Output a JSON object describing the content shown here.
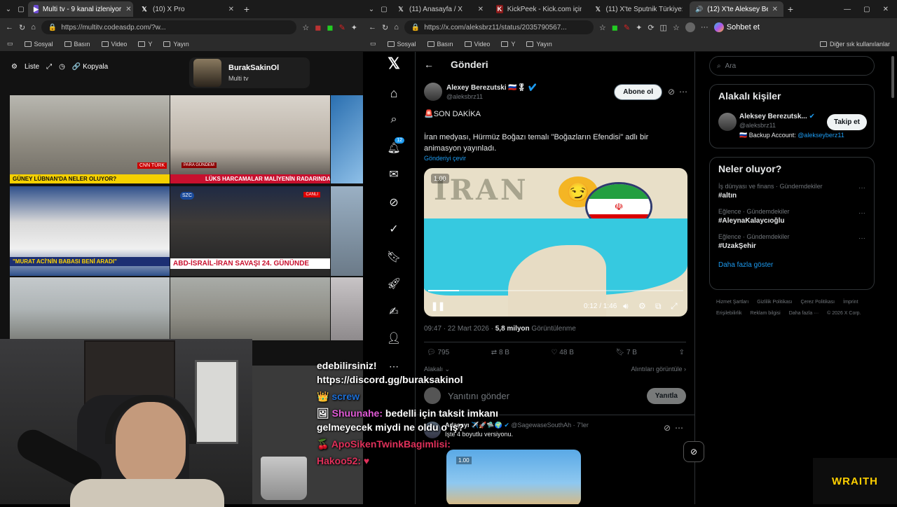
{
  "left_window": {
    "tabs": [
      {
        "label": "Multi tv - 9 kanal izleniyor",
        "active": true
      },
      {
        "label": "(10) X Pro",
        "active": false
      }
    ],
    "url": "https://multitv.codeasdp.com/?w...",
    "bookmarks": [
      "Sosyal",
      "Basın",
      "Video",
      "Y",
      "Yayın"
    ]
  },
  "right_window": {
    "tabs": [
      {
        "label": "(11) Anasayfa / X"
      },
      {
        "label": "KickPeek - Kick.com için Geç"
      },
      {
        "label": "(11) X'te Sputnik Türkiye: \"D"
      },
      {
        "label": "(12) X'te Aleksey Berezuts",
        "active": true
      }
    ],
    "url": "https://x.com/aleksbrz11/status/2035790567...",
    "bookmarks": [
      "Sosyal",
      "Basın",
      "Video",
      "Y",
      "Yayın"
    ],
    "other_bookmarks": "Diğer sık kullanılanlar",
    "copilot": "Sohbet et"
  },
  "multitv": {
    "toolbar": {
      "list": "Liste",
      "copy": "Kopyala"
    },
    "profile": {
      "name": "BurakSakinOl",
      "subtitle": "Multi tv"
    },
    "tickers": [
      "GÜNEY LÜBNAN'DA NELER OLUYOR?",
      "LÜKS HARCAMALAR MALİYENİN RADARINDA",
      "\"MURAT ACİ'NİN BABASI BENİ ARADI\"",
      "ABD-İSRAİL-İRAN SAVAŞI 24. GÜNÜNDE"
    ],
    "channel_labels": [
      "CNN TÜRK",
      "SZC",
      "CANLI",
      "PARA GÜNDEM"
    ]
  },
  "chat": [
    {
      "user": "",
      "text": "edebilirsiniz! https://discord.gg/buraksakinol"
    },
    {
      "user": "screw",
      "text": ""
    },
    {
      "user": "Shuunahe:",
      "text": "bedelli için taksit imkanı gelmeyecek miydi ne oldu o iş?"
    },
    {
      "user": "ApoSikenTwinkBagimlisi:",
      "text": ""
    },
    {
      "user": "Hakoo52:",
      "text": ""
    }
  ],
  "x": {
    "header": "Gönderi",
    "notif_badge": "12",
    "search_placeholder": "Ara",
    "post": {
      "name": "Alexey Berezutski 🇷🇺🎖",
      "handle": "@aleksbrz11",
      "follow": "Abone ol",
      "line1": "🚨SON DAKİKA",
      "body": "İran medyası, Hürmüz Boğazı temalı \"Boğazların Efendisi\" adlı bir animasyon yayınladı.",
      "translate": "Gönderiyi çevir",
      "video": {
        "title": "IRAN",
        "rate": "1.00",
        "time": "0:12 / 1:46",
        "progress": 0.12
      },
      "time": "09:47 · 22 Mart 2026 · ",
      "views": "5,8 milyon",
      "views_label": "Görüntülenme",
      "stats": {
        "replies": "795",
        "reposts": "8 B",
        "likes": "48 B",
        "bookmarks": "7 B"
      },
      "relevant": "Alakalı",
      "quotes": "Alıntıları görüntüle",
      "reply_placeholder": "Yanıtını gönder",
      "reply_btn": "Yanıtla"
    },
    "reply": {
      "name": "Adaçayı ✈️🚀🛸🌍",
      "handle": "@SagewaseSouthAh · 7'ler",
      "text": "İşte 4 boyutlu versiyonu.",
      "rate": "1.00"
    },
    "sidebar": {
      "people_title": "Alakalı kişiler",
      "person": {
        "name": "Aleksey Berezutsk...",
        "handle": "@aleksbrz11",
        "bio": "🇷🇺 Backup Account: ",
        "bio_link": "@alekseyberz11",
        "follow": "Takip et"
      },
      "trends_title": "Neler oluyor?",
      "trends": [
        {
          "meta": "İş dünyası ve finans · Gündemdekiler",
          "tag": "#altın"
        },
        {
          "meta": "Eğlence · Gündemdekiler",
          "tag": "#AleynaKalaycıoğlu"
        },
        {
          "meta": "Eğlence · Gündemdekiler",
          "tag": "#UzakŞehir"
        }
      ],
      "show_more": "Daha fazla göster",
      "footer": [
        "Hizmet Şartları",
        "Gizlilik Politikası",
        "Çerez Politikası",
        "İmprint",
        "Erişilebilirlik",
        "Reklam bilgisi",
        "Daha fazla ···",
        "© 2026 X Corp."
      ]
    }
  },
  "overlay": {
    "brand": "WRAITH"
  },
  "colors": {
    "x_blue": "#1d9bf0",
    "ticker_yellow": "#ffd400",
    "ticker_red": "#c8102e"
  }
}
